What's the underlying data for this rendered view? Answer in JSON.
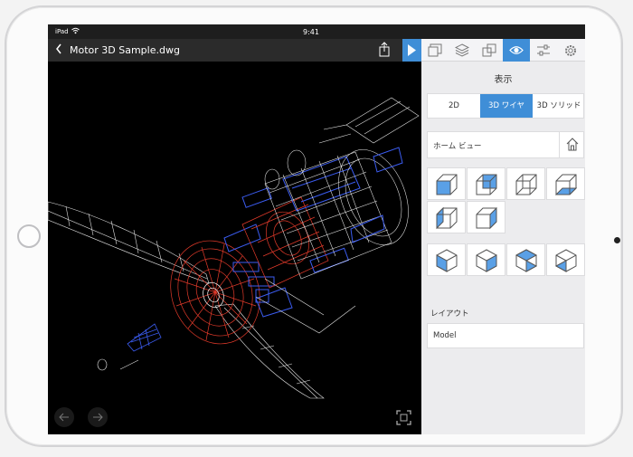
{
  "status": {
    "carrier": "iPad",
    "wifi_icon": "wifi-icon",
    "time": "9:41"
  },
  "titlebar": {
    "back_icon": "chevron-left-icon",
    "title": "Motor 3D Sample.dwg",
    "share_icon": "share-icon",
    "panel_toggle_icon": "panel-toggle-icon"
  },
  "panel": {
    "tabs": [
      {
        "icon": "view-2d-icon",
        "active": false
      },
      {
        "icon": "layers-icon",
        "active": false
      },
      {
        "icon": "blocks-icon",
        "active": false
      },
      {
        "icon": "eye-icon",
        "active": true
      },
      {
        "icon": "sliders-icon",
        "active": false
      },
      {
        "icon": "gear-icon",
        "active": false
      }
    ],
    "title": "表示",
    "modes": [
      "2D",
      "3D ワイヤ",
      "3D ソリッド"
    ],
    "active_mode": "3D ワイヤ",
    "home_view_label": "ホーム ビュー",
    "home_icon": "home-icon",
    "layout_label": "レイアウト",
    "layout_value": "Model"
  },
  "viewport": {
    "undo_icon": "undo-icon",
    "redo_icon": "redo-icon",
    "fullscreen_icon": "fullscreen-icon"
  },
  "colors": {
    "accent": "#3f8ed7",
    "wire_red": "#e23a2a",
    "wire_blue": "#2f4fe0",
    "wire_white": "#ffffff"
  }
}
